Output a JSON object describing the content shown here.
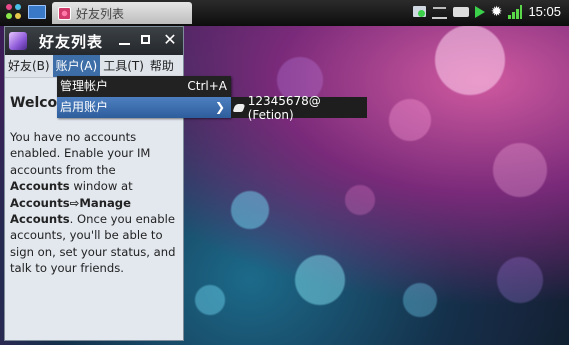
{
  "statusbar": {
    "task_title": "好友列表",
    "clock": "15:05",
    "icons": [
      "apps-grid-icon",
      "desktop-icon",
      "network-icon",
      "signal-bars-icon",
      "storage-icon",
      "play-icon",
      "brightness-icon",
      "cell-signal-icon"
    ]
  },
  "window": {
    "title": "好友列表",
    "menus": [
      "好友(B)",
      "账户(A)",
      "工具(T)",
      "帮助"
    ],
    "active_menu_index": 1
  },
  "content": {
    "welcome": "Welco",
    "body_parts": [
      {
        "text": "You have no accounts enabled. Enable your IM accounts from the ",
        "bold": false
      },
      {
        "text": "Accounts",
        "bold": true
      },
      {
        "text": " window at ",
        "bold": false
      },
      {
        "text": "Accounts⇨Manage Accounts",
        "bold": true
      },
      {
        "text": ". Once you enable accounts, you'll be able to sign on, set your status, and talk to your friends.",
        "bold": false
      }
    ]
  },
  "dropdown": {
    "items": [
      {
        "label": "管理帐户",
        "shortcut": "Ctrl+A"
      },
      {
        "label": "启用账户",
        "shortcut": ""
      }
    ],
    "submenu_item": "12345678@ (Fetion)"
  },
  "colors": {
    "menu_highlight": "#3e6ea8",
    "dropdown_bg": "#222222"
  }
}
